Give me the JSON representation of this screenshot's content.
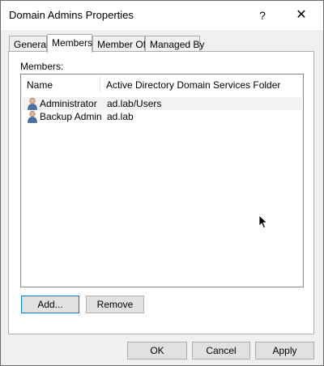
{
  "window": {
    "title": "Domain Admins Properties",
    "help_label": "?",
    "close_label": "✕"
  },
  "tabs": [
    {
      "label": "General",
      "active": false
    },
    {
      "label": "Members",
      "active": true
    },
    {
      "label": "Member Of",
      "active": false
    },
    {
      "label": "Managed By",
      "active": false
    }
  ],
  "members": {
    "label": "Members:",
    "columns": [
      "Name",
      "Active Directory Domain Services Folder"
    ],
    "rows": [
      {
        "name": "Administrator",
        "folder": "ad.lab/Users",
        "icon": "user-icon"
      },
      {
        "name": "Backup Admin",
        "folder": "ad.lab",
        "icon": "user-icon"
      }
    ],
    "add_label": "Add...",
    "remove_label": "Remove"
  },
  "footer": {
    "ok_label": "OK",
    "cancel_label": "Cancel",
    "apply_label": "Apply"
  },
  "colors": {
    "accent": "#0078d7",
    "dialog_bg": "#f0f0f0",
    "button_bg": "#e1e1e1"
  }
}
